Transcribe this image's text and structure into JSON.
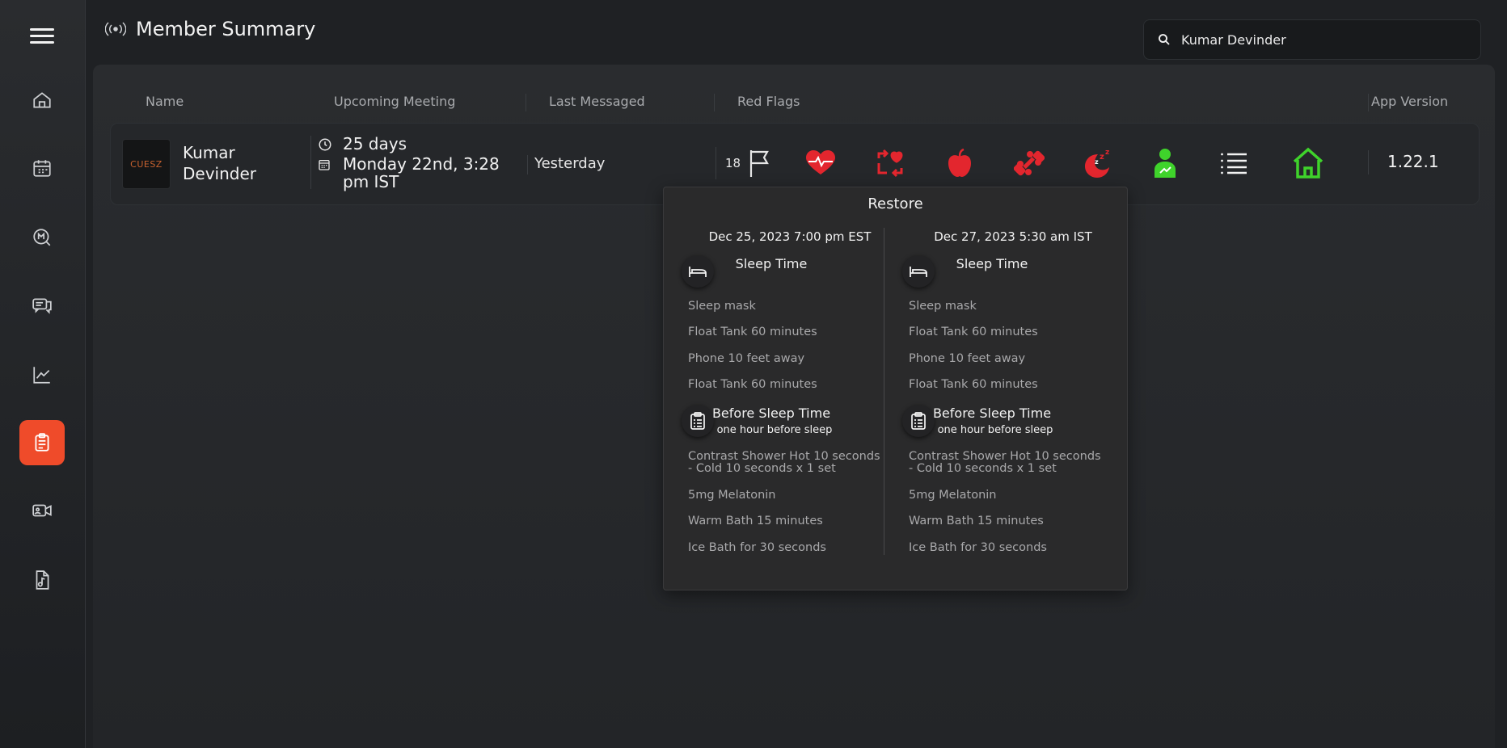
{
  "header": {
    "title": "Member Summary",
    "broadcast_icon": "broadcast-icon"
  },
  "search": {
    "value": "Kumar Devinder",
    "icon": "search-icon"
  },
  "sidebar": {
    "items": [
      {
        "name": "home",
        "icon": "home-icon"
      },
      {
        "name": "calendar",
        "icon": "calendar-icon"
      },
      {
        "name": "messages",
        "icon": "message-search-icon"
      },
      {
        "name": "chat",
        "icon": "chat-icon"
      },
      {
        "name": "analytics",
        "icon": "chart-icon"
      },
      {
        "name": "plans",
        "icon": "clipboard-icon",
        "active": true
      },
      {
        "name": "video",
        "icon": "video-icon"
      },
      {
        "name": "media",
        "icon": "music-file-icon"
      }
    ],
    "active_color": "#ef4b2a"
  },
  "table": {
    "headers": {
      "name": "Name",
      "meeting": "Upcoming Meeting",
      "messaged": "Last Messaged",
      "flags": "Red Flags",
      "version": "App Version"
    },
    "row": {
      "logo_text": "CUESZ",
      "name": "Kumar Devinder",
      "meeting_days": "25 days",
      "meeting_date": "Monday 22nd, 3:28 pm IST",
      "last_messaged": "Yesterday",
      "flag_count": "18",
      "flags": [
        "flag-icon",
        "heart-rate-icon",
        "heart-exchange-icon",
        "apple-icon",
        "dumbbell-icon",
        "sleep-moon-icon",
        "person-icon",
        "list-icon",
        "house-icon"
      ],
      "app_version": "1.22.1"
    }
  },
  "popup": {
    "title": "Restore",
    "columns": [
      {
        "date": "Dec 25, 2023 7:00 pm EST",
        "sleep_title": "Sleep Time",
        "sleep_items": [
          "Sleep mask",
          "Float Tank 60 minutes",
          "Phone 10 feet away",
          "Float Tank 60 minutes"
        ],
        "before_title": "Before Sleep Time",
        "before_sub": "one hour before sleep",
        "before_items": [
          "Contrast Shower Hot 10 seconds - Cold 10 seconds x 1 set",
          "5mg Melatonin",
          "Warm Bath 15 minutes",
          "Ice Bath for 30 seconds"
        ]
      },
      {
        "date": "Dec 27, 2023 5:30 am IST",
        "sleep_title": "Sleep Time",
        "sleep_items": [
          "Sleep mask",
          "Float Tank 60 minutes",
          "Phone 10 feet away",
          "Float Tank 60 minutes"
        ],
        "before_title": "Before Sleep Time",
        "before_sub": "one hour before sleep",
        "before_items": [
          "Contrast Shower Hot 10 seconds - Cold 10 seconds x 1 set",
          "5mg Melatonin",
          "Warm Bath 15 minutes",
          "Ice Bath for 30 seconds"
        ]
      }
    ]
  },
  "colors": {
    "red_flag": "#e3262e",
    "green_status": "#3fd32b",
    "accent": "#ef4b2a"
  }
}
